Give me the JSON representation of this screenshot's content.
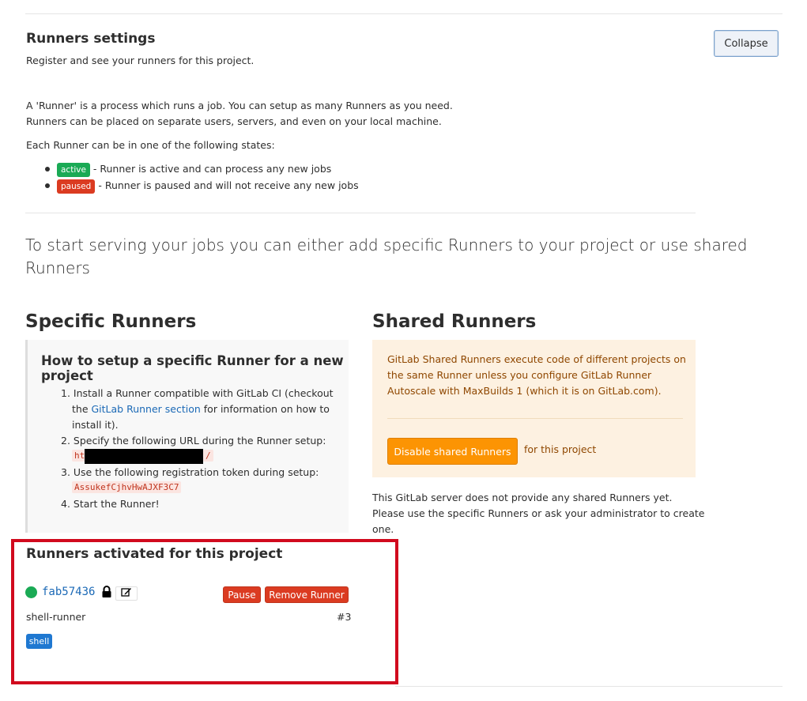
{
  "header": {
    "title": "Runners settings",
    "subtitle": "Register and see your runners for this project.",
    "collapse_label": "Collapse"
  },
  "intro": {
    "line1": "A 'Runner' is a process which runs a job. You can setup as many Runners as you need.",
    "line2": "Runners can be placed on separate users, servers, and even on your local machine.",
    "states_heading": "Each Runner can be in one of the following states:",
    "states": [
      {
        "badge": "active",
        "text": "- Runner is active and can process any new jobs",
        "color": "#1aaa55"
      },
      {
        "badge": "paused",
        "text": "- Runner is paused and will not receive any new jobs",
        "color": "#db3b21"
      }
    ]
  },
  "lead": {
    "line1": "To start serving your jobs you can either add specific Runners to your project or use shared",
    "line2": "Runners"
  },
  "specific": {
    "heading": "Specific Runners",
    "howto_line1": "How to setup a specific Runner for a new",
    "howto_line2": "project",
    "step1_a": "1. Install a Runner compatible with GitLab CI (checkout",
    "step1_b_pre": "the ",
    "step1_link": "GitLab Runner section",
    "step1_b_post": " for information on how to",
    "step1_c": "install it).",
    "step2": "2. Specify the following URL during the Runner setup:",
    "url_start": "ht",
    "url_end": "/",
    "step3": "3. Use the following registration token during setup:",
    "token": "AssukefCjhvHwAJXF3C7",
    "step4": "4. Start the Runner!"
  },
  "shared": {
    "heading": "Shared Runners",
    "info_line1": "GitLab Shared Runners execute code of different projects on",
    "info_line2": "the same Runner unless you configure GitLab Runner",
    "info_line3": "Autoscale with MaxBuilds 1 (which it is on GitLab.com).",
    "disable_label": "Disable shared Runners",
    "for_project": "for this project",
    "none_line1": "This GitLab server does not provide any shared Runners yet.",
    "none_line2": "Please use the specific Runners or ask your administrator to create",
    "none_line3": "one."
  },
  "activated": {
    "heading": "Runners activated for this project",
    "runner": {
      "id": "fab57436",
      "description": "shell-runner",
      "number": "#3",
      "tag": "shell",
      "pause_label": "Pause",
      "remove_label": "Remove Runner",
      "status_color": "#1aaa55"
    }
  },
  "colors": {
    "link": "#1b69b6",
    "highlight_frame": "#d10a1e",
    "warning_bg": "#fdf1e1",
    "warning_button": "#fc9403"
  }
}
